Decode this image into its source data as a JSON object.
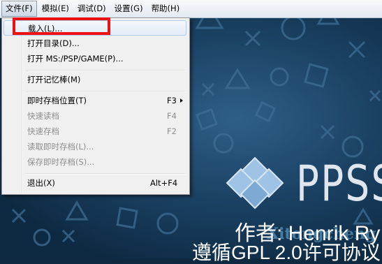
{
  "menubar": {
    "items": [
      {
        "label": "文件(F)"
      },
      {
        "label": "模拟(E)"
      },
      {
        "label": "调试(D)"
      },
      {
        "label": "设置(G)"
      },
      {
        "label": "帮助(H)"
      }
    ]
  },
  "file_menu": {
    "items": [
      {
        "label": "载入(L)...",
        "shortcut": "",
        "enabled": true,
        "highlighted": true
      },
      {
        "label": "打开目录(D)...",
        "shortcut": "",
        "enabled": true
      },
      {
        "label": "打开 MS:/PSP/GAME(P)...",
        "shortcut": "",
        "enabled": true
      },
      {
        "label": "打开记忆棒(M)",
        "shortcut": "",
        "enabled": true
      },
      {
        "label": "即时存档位置(T)",
        "shortcut": "F3",
        "enabled": true,
        "submenu": true
      },
      {
        "label": "快速读档",
        "shortcut": "F4",
        "enabled": false
      },
      {
        "label": "快速存档",
        "shortcut": "F2",
        "enabled": false
      },
      {
        "label": "读取即时存档(L)...",
        "shortcut": "",
        "enabled": false
      },
      {
        "label": "保存即时存档(S)...",
        "shortcut": "",
        "enabled": false
      },
      {
        "label": "退出(X)",
        "shortcut": "Alt+F4",
        "enabled": true
      }
    ]
  },
  "splash": {
    "logo_text": "PPSS",
    "author": "作者: Henrik Ry",
    "license": "遵循GPL 2.0许可协议",
    "watermark": "Xitongcheng"
  },
  "colors": {
    "highlight_box": "#ee1111",
    "background": "#1c4467"
  }
}
